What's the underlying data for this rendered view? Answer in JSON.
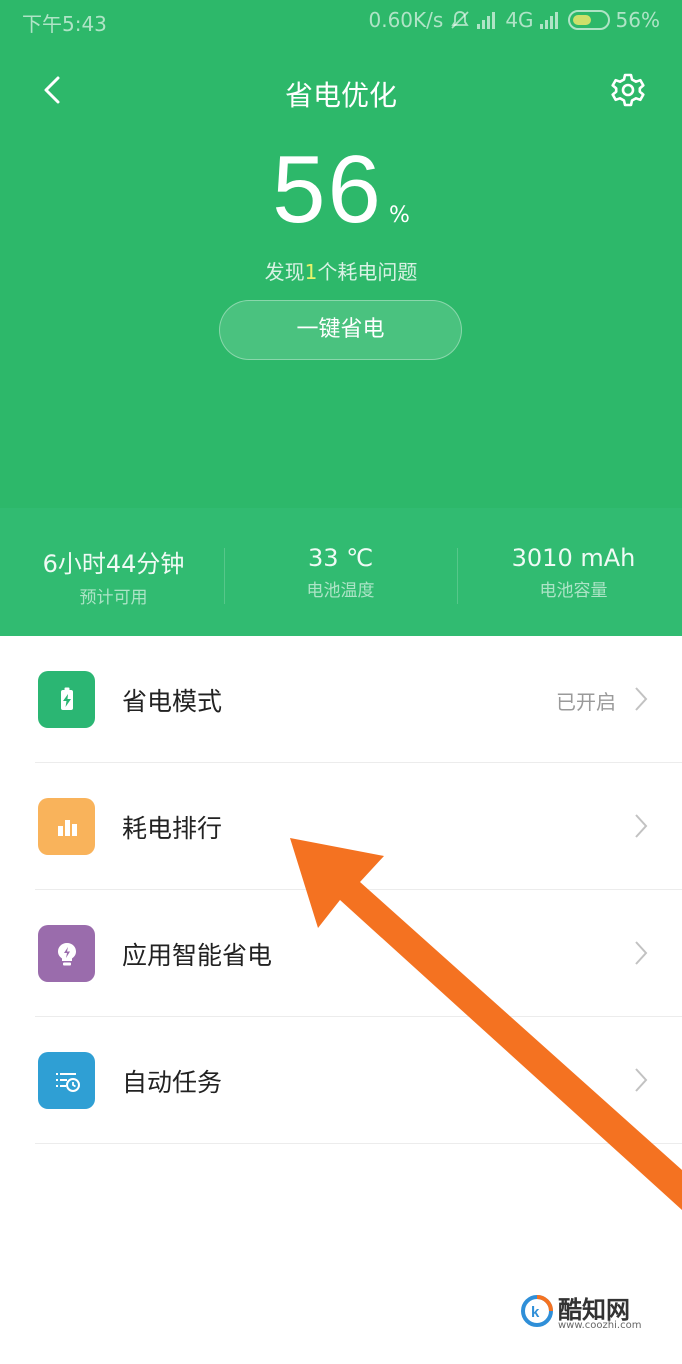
{
  "statusbar": {
    "time": "下午5:43",
    "speed": "0.60K/s",
    "network": "4G",
    "battery": "56%",
    "battery_level": 0.56
  },
  "header": {
    "title": "省电优化",
    "percent": "56",
    "percent_unit": "%",
    "issue_prefix": "发现",
    "issue_count": "1",
    "issue_suffix": "个耗电问题",
    "save_button": "一键省电",
    "bg_color": "#2db86a"
  },
  "stats": [
    {
      "value": "6小时44分钟",
      "label": "预计可用"
    },
    {
      "value": "33 ℃",
      "label": "电池温度"
    },
    {
      "value": "3010 mAh",
      "label": "电池容量"
    }
  ],
  "menu": [
    {
      "label": "省电模式",
      "status": "已开启",
      "icon": "battery-charge-icon",
      "color": "#2bb673"
    },
    {
      "label": "耗电排行",
      "status": "",
      "icon": "bar-chart-icon",
      "color": "#f9b35b"
    },
    {
      "label": "应用智能省电",
      "status": "",
      "icon": "lightbulb-icon",
      "color": "#9a6cac"
    },
    {
      "label": "自动任务",
      "status": "",
      "icon": "list-clock-icon",
      "color": "#2f9fd4"
    }
  ],
  "annotation": {
    "arrow_color": "#f47221"
  },
  "watermark": {
    "name": "酷知网",
    "url": "www.coozhi.com"
  }
}
